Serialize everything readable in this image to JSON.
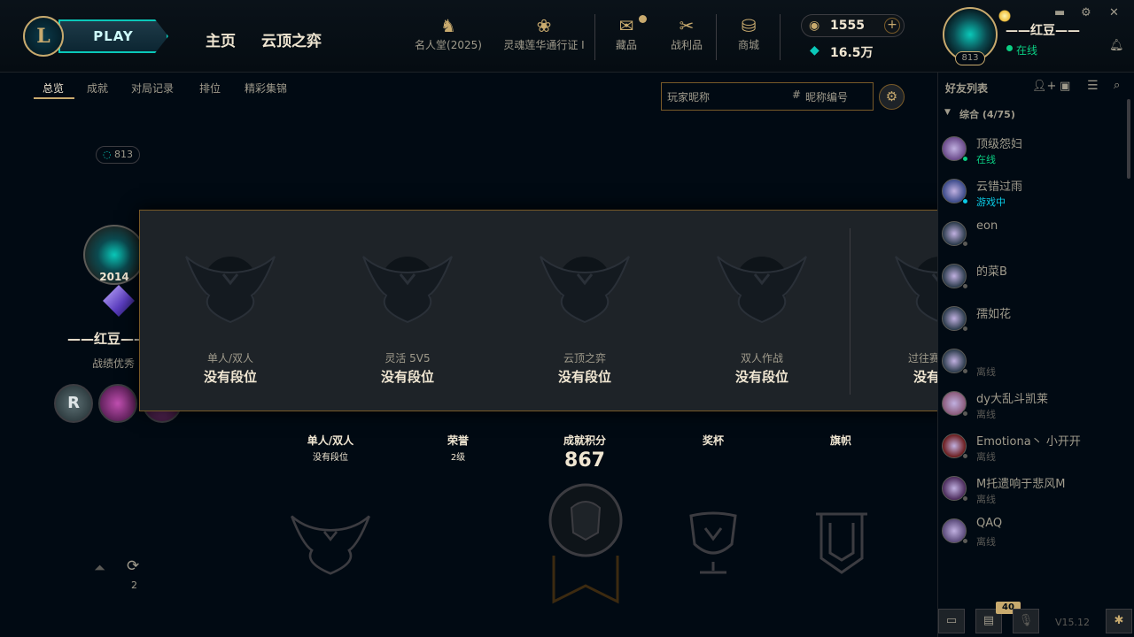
{
  "header": {
    "play_label": "PLAY",
    "nav": {
      "home": "主页",
      "tft": "云顶之弈"
    },
    "icons_nav": [
      {
        "label": "名人堂(2025)",
        "icon": "hall-of-fame-icon"
      },
      {
        "label": "灵魂莲华通行证 I",
        "icon": "lotus-pass-icon"
      },
      {
        "label": "藏品",
        "icon": "collection-icon"
      },
      {
        "label": "战利品",
        "icon": "loot-icon"
      },
      {
        "label": "商城",
        "icon": "store-icon"
      }
    ],
    "rp": "1555",
    "blue_essence": "16.5万",
    "summoner_name": "——红豆——",
    "status": "在线",
    "level": "813",
    "colors": {
      "accent_gold": "#c8aa6e",
      "teal": "#0ac8b9",
      "online": "#0acf83"
    }
  },
  "subnav": {
    "tabs": [
      "总览",
      "成就",
      "对局记录",
      "排位",
      "精彩集锦"
    ],
    "active": "总览",
    "search_placeholder": "玩家昵称",
    "tag_label": "昵称编号"
  },
  "profile": {
    "level": "813",
    "crest_year": "2014",
    "name": "——红豆——",
    "subtitle": "战绩优秀"
  },
  "rank_popup": {
    "queues": [
      {
        "queue": "单人/双人",
        "tier": "没有段位"
      },
      {
        "queue": "灵活 5V5",
        "tier": "没有段位"
      },
      {
        "queue": "云顶之弈",
        "tier": "没有段位"
      },
      {
        "queue": "双人作战",
        "tier": "没有段位"
      },
      {
        "queue": "过往赛季排位",
        "tier": "没有段位"
      }
    ]
  },
  "stats": {
    "solo_label": "单人/双人",
    "solo_value": "没有段位",
    "honor_label": "荣誉",
    "honor_value": "2级",
    "points_label": "成就积分",
    "points_value": "867",
    "trophy_label": "奖杯",
    "banner_label": "旗帜",
    "reroll_count": "2"
  },
  "friends": {
    "title": "好友列表",
    "group": "综合 (4/75)",
    "list": [
      {
        "name": "顶级怨妇",
        "status": "在线",
        "status_color": "#0acf83"
      },
      {
        "name": "云错过雨",
        "status": "游戏中",
        "status_color": "#0acbe6"
      },
      {
        "name": "eon",
        "status": "",
        "status_color": "#5b5a56"
      },
      {
        "name": "的菜B",
        "status": "",
        "status_color": "#5b5a56"
      },
      {
        "name": "孺如花",
        "status": "",
        "status_color": "#5b5a56"
      },
      {
        "name": "",
        "status": "离线",
        "status_color": "#5b5a56"
      },
      {
        "name": "dy大乱斗凯莱",
        "status": "离线",
        "status_color": "#5b5a56"
      },
      {
        "name": "Emotiona丶 小开开",
        "status": "离线",
        "status_color": "#5b5a56"
      },
      {
        "name": "M托遗响于悲风M",
        "status": "离线",
        "status_color": "#5b5a56"
      },
      {
        "name": "QAQ",
        "status": "离线",
        "status_color": "#5b5a56"
      }
    ]
  },
  "footer": {
    "notifications": "40",
    "version": "V15.12"
  }
}
